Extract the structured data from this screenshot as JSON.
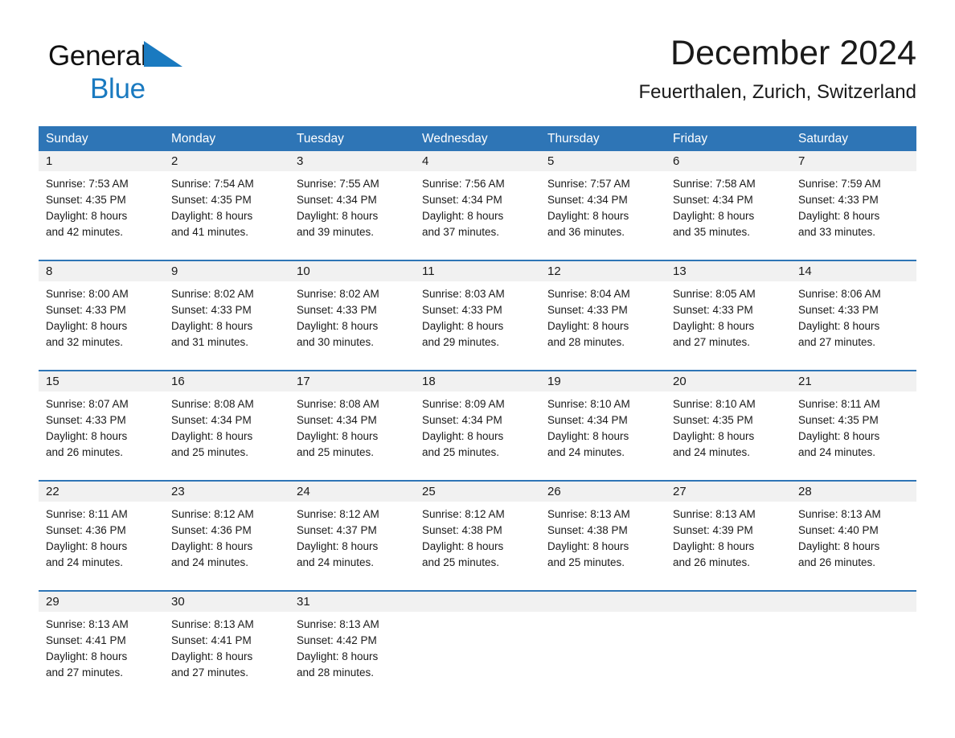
{
  "brand": {
    "name_part1": "General",
    "name_part2": "Blue",
    "triangle_icon": "blue-triangle-icon",
    "accent_color": "#1a7ac0"
  },
  "header": {
    "title": "December 2024",
    "subtitle": "Feuerthalen, Zurich, Switzerland"
  },
  "colors": {
    "header_blue": "#2e75b6",
    "day_band_gray": "#f1f1f1",
    "text": "#1a1a1a"
  },
  "weekdays": [
    "Sunday",
    "Monday",
    "Tuesday",
    "Wednesday",
    "Thursday",
    "Friday",
    "Saturday"
  ],
  "weeks": [
    [
      {
        "day": "1",
        "sunrise": "Sunrise: 7:53 AM",
        "sunset": "Sunset: 4:35 PM",
        "daylight_line1": "Daylight: 8 hours",
        "daylight_line2": "and 42 minutes."
      },
      {
        "day": "2",
        "sunrise": "Sunrise: 7:54 AM",
        "sunset": "Sunset: 4:35 PM",
        "daylight_line1": "Daylight: 8 hours",
        "daylight_line2": "and 41 minutes."
      },
      {
        "day": "3",
        "sunrise": "Sunrise: 7:55 AM",
        "sunset": "Sunset: 4:34 PM",
        "daylight_line1": "Daylight: 8 hours",
        "daylight_line2": "and 39 minutes."
      },
      {
        "day": "4",
        "sunrise": "Sunrise: 7:56 AM",
        "sunset": "Sunset: 4:34 PM",
        "daylight_line1": "Daylight: 8 hours",
        "daylight_line2": "and 37 minutes."
      },
      {
        "day": "5",
        "sunrise": "Sunrise: 7:57 AM",
        "sunset": "Sunset: 4:34 PM",
        "daylight_line1": "Daylight: 8 hours",
        "daylight_line2": "and 36 minutes."
      },
      {
        "day": "6",
        "sunrise": "Sunrise: 7:58 AM",
        "sunset": "Sunset: 4:34 PM",
        "daylight_line1": "Daylight: 8 hours",
        "daylight_line2": "and 35 minutes."
      },
      {
        "day": "7",
        "sunrise": "Sunrise: 7:59 AM",
        "sunset": "Sunset: 4:33 PM",
        "daylight_line1": "Daylight: 8 hours",
        "daylight_line2": "and 33 minutes."
      }
    ],
    [
      {
        "day": "8",
        "sunrise": "Sunrise: 8:00 AM",
        "sunset": "Sunset: 4:33 PM",
        "daylight_line1": "Daylight: 8 hours",
        "daylight_line2": "and 32 minutes."
      },
      {
        "day": "9",
        "sunrise": "Sunrise: 8:02 AM",
        "sunset": "Sunset: 4:33 PM",
        "daylight_line1": "Daylight: 8 hours",
        "daylight_line2": "and 31 minutes."
      },
      {
        "day": "10",
        "sunrise": "Sunrise: 8:02 AM",
        "sunset": "Sunset: 4:33 PM",
        "daylight_line1": "Daylight: 8 hours",
        "daylight_line2": "and 30 minutes."
      },
      {
        "day": "11",
        "sunrise": "Sunrise: 8:03 AM",
        "sunset": "Sunset: 4:33 PM",
        "daylight_line1": "Daylight: 8 hours",
        "daylight_line2": "and 29 minutes."
      },
      {
        "day": "12",
        "sunrise": "Sunrise: 8:04 AM",
        "sunset": "Sunset: 4:33 PM",
        "daylight_line1": "Daylight: 8 hours",
        "daylight_line2": "and 28 minutes."
      },
      {
        "day": "13",
        "sunrise": "Sunrise: 8:05 AM",
        "sunset": "Sunset: 4:33 PM",
        "daylight_line1": "Daylight: 8 hours",
        "daylight_line2": "and 27 minutes."
      },
      {
        "day": "14",
        "sunrise": "Sunrise: 8:06 AM",
        "sunset": "Sunset: 4:33 PM",
        "daylight_line1": "Daylight: 8 hours",
        "daylight_line2": "and 27 minutes."
      }
    ],
    [
      {
        "day": "15",
        "sunrise": "Sunrise: 8:07 AM",
        "sunset": "Sunset: 4:33 PM",
        "daylight_line1": "Daylight: 8 hours",
        "daylight_line2": "and 26 minutes."
      },
      {
        "day": "16",
        "sunrise": "Sunrise: 8:08 AM",
        "sunset": "Sunset: 4:34 PM",
        "daylight_line1": "Daylight: 8 hours",
        "daylight_line2": "and 25 minutes."
      },
      {
        "day": "17",
        "sunrise": "Sunrise: 8:08 AM",
        "sunset": "Sunset: 4:34 PM",
        "daylight_line1": "Daylight: 8 hours",
        "daylight_line2": "and 25 minutes."
      },
      {
        "day": "18",
        "sunrise": "Sunrise: 8:09 AM",
        "sunset": "Sunset: 4:34 PM",
        "daylight_line1": "Daylight: 8 hours",
        "daylight_line2": "and 25 minutes."
      },
      {
        "day": "19",
        "sunrise": "Sunrise: 8:10 AM",
        "sunset": "Sunset: 4:34 PM",
        "daylight_line1": "Daylight: 8 hours",
        "daylight_line2": "and 24 minutes."
      },
      {
        "day": "20",
        "sunrise": "Sunrise: 8:10 AM",
        "sunset": "Sunset: 4:35 PM",
        "daylight_line1": "Daylight: 8 hours",
        "daylight_line2": "and 24 minutes."
      },
      {
        "day": "21",
        "sunrise": "Sunrise: 8:11 AM",
        "sunset": "Sunset: 4:35 PM",
        "daylight_line1": "Daylight: 8 hours",
        "daylight_line2": "and 24 minutes."
      }
    ],
    [
      {
        "day": "22",
        "sunrise": "Sunrise: 8:11 AM",
        "sunset": "Sunset: 4:36 PM",
        "daylight_line1": "Daylight: 8 hours",
        "daylight_line2": "and 24 minutes."
      },
      {
        "day": "23",
        "sunrise": "Sunrise: 8:12 AM",
        "sunset": "Sunset: 4:36 PM",
        "daylight_line1": "Daylight: 8 hours",
        "daylight_line2": "and 24 minutes."
      },
      {
        "day": "24",
        "sunrise": "Sunrise: 8:12 AM",
        "sunset": "Sunset: 4:37 PM",
        "daylight_line1": "Daylight: 8 hours",
        "daylight_line2": "and 24 minutes."
      },
      {
        "day": "25",
        "sunrise": "Sunrise: 8:12 AM",
        "sunset": "Sunset: 4:38 PM",
        "daylight_line1": "Daylight: 8 hours",
        "daylight_line2": "and 25 minutes."
      },
      {
        "day": "26",
        "sunrise": "Sunrise: 8:13 AM",
        "sunset": "Sunset: 4:38 PM",
        "daylight_line1": "Daylight: 8 hours",
        "daylight_line2": "and 25 minutes."
      },
      {
        "day": "27",
        "sunrise": "Sunrise: 8:13 AM",
        "sunset": "Sunset: 4:39 PM",
        "daylight_line1": "Daylight: 8 hours",
        "daylight_line2": "and 26 minutes."
      },
      {
        "day": "28",
        "sunrise": "Sunrise: 8:13 AM",
        "sunset": "Sunset: 4:40 PM",
        "daylight_line1": "Daylight: 8 hours",
        "daylight_line2": "and 26 minutes."
      }
    ],
    [
      {
        "day": "29",
        "sunrise": "Sunrise: 8:13 AM",
        "sunset": "Sunset: 4:41 PM",
        "daylight_line1": "Daylight: 8 hours",
        "daylight_line2": "and 27 minutes."
      },
      {
        "day": "30",
        "sunrise": "Sunrise: 8:13 AM",
        "sunset": "Sunset: 4:41 PM",
        "daylight_line1": "Daylight: 8 hours",
        "daylight_line2": "and 27 minutes."
      },
      {
        "day": "31",
        "sunrise": "Sunrise: 8:13 AM",
        "sunset": "Sunset: 4:42 PM",
        "daylight_line1": "Daylight: 8 hours",
        "daylight_line2": "and 28 minutes."
      },
      {
        "day": "",
        "sunrise": "",
        "sunset": "",
        "daylight_line1": "",
        "daylight_line2": ""
      },
      {
        "day": "",
        "sunrise": "",
        "sunset": "",
        "daylight_line1": "",
        "daylight_line2": ""
      },
      {
        "day": "",
        "sunrise": "",
        "sunset": "",
        "daylight_line1": "",
        "daylight_line2": ""
      },
      {
        "day": "",
        "sunrise": "",
        "sunset": "",
        "daylight_line1": "",
        "daylight_line2": ""
      }
    ]
  ]
}
